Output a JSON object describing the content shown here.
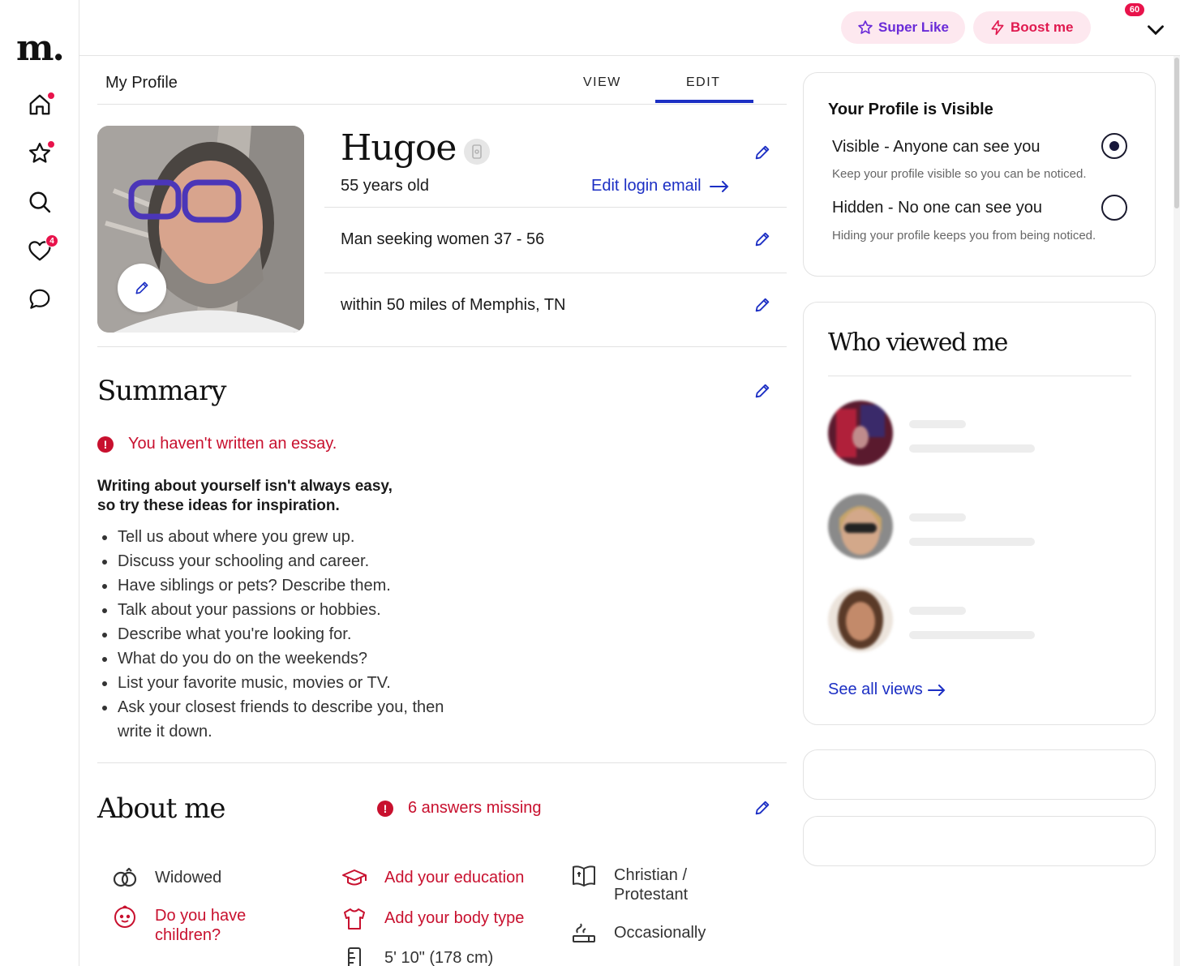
{
  "brand": {
    "logo": "m."
  },
  "nav": {
    "home": "home-icon",
    "favorites": "star-icon",
    "search": "search-icon",
    "likes": "heart-icon",
    "likes_badge": "4",
    "messages": "chat-icon"
  },
  "topbar": {
    "super_like": "Super Like",
    "boost": "Boost me",
    "account_badge": "60"
  },
  "profile": {
    "page_title": "My Profile",
    "tabs": [
      "VIEW",
      "EDIT"
    ],
    "active_tab": "EDIT",
    "name": "Hugoe",
    "age": "55 years old",
    "edit_email": "Edit login email",
    "seeking": "Man seeking women 37 - 56",
    "location": "within 50 miles of Memphis, TN"
  },
  "summary": {
    "title": "Summary",
    "warning": "You haven't written an essay.",
    "inspiration_line1": "Writing about yourself isn't always easy,",
    "inspiration_line2": "so try these ideas for inspiration.",
    "ideas": [
      "Tell us about where you grew up.",
      "Discuss your schooling and career.",
      "Have siblings or pets? Describe them.",
      "Talk about your passions or hobbies.",
      "Describe what you're looking for.",
      "What do you do on the weekends?",
      "List your favorite music, movies or TV.",
      "Ask your closest friends to describe you, then write it down."
    ]
  },
  "about": {
    "title": "About me",
    "missing": "6 answers missing",
    "items": {
      "marital": "Widowed",
      "children": "Do you have children?",
      "education": "Add your education",
      "body_type": "Add your body type",
      "height": "5' 10\" (178 cm)",
      "religion": "Christian / Protestant",
      "smoking": "Occasionally"
    }
  },
  "visibility": {
    "title": "Your Profile is Visible",
    "visible_label": "Visible - Anyone can see you",
    "visible_sub": "Keep your profile visible so you can be noticed.",
    "hidden_label": "Hidden - No one can see you",
    "hidden_sub": "Hiding your profile keeps you from being noticed.",
    "selected": "visible"
  },
  "views": {
    "title": "Who viewed me",
    "see_all": "See all views"
  },
  "colors": {
    "accent_blue": "#1c2fc4",
    "alert_red": "#c8102e",
    "super_like_purple": "#6a2bd8",
    "boost_pink": "#e0194f"
  }
}
